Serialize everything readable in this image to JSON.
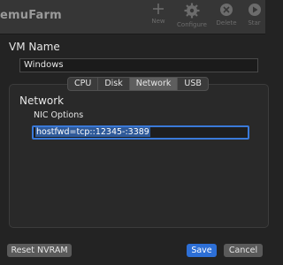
{
  "app": {
    "title": "emuFarm"
  },
  "toolbar": {
    "new_label": "New",
    "configure_label": "Configure",
    "delete_label": "Delete",
    "start_label": "Star"
  },
  "form": {
    "vm_name_label": "VM Name",
    "vm_name_value": "Windows"
  },
  "tabs": [
    {
      "label": "CPU",
      "active": false
    },
    {
      "label": "Disk",
      "active": false
    },
    {
      "label": "Network",
      "active": true
    },
    {
      "label": "USB",
      "active": false
    }
  ],
  "network": {
    "title": "Network",
    "nic_label": "NIC Options",
    "nic_value": "hostfwd=tcp::12345-:3389"
  },
  "buttons": {
    "reset": "Reset NVRAM",
    "save": "Save",
    "cancel": "Cancel"
  },
  "colors": {
    "accent": "#2d6fd6",
    "background": "#232323",
    "toolbar_background": "#363636",
    "focus_ring": "#3a79d8"
  }
}
